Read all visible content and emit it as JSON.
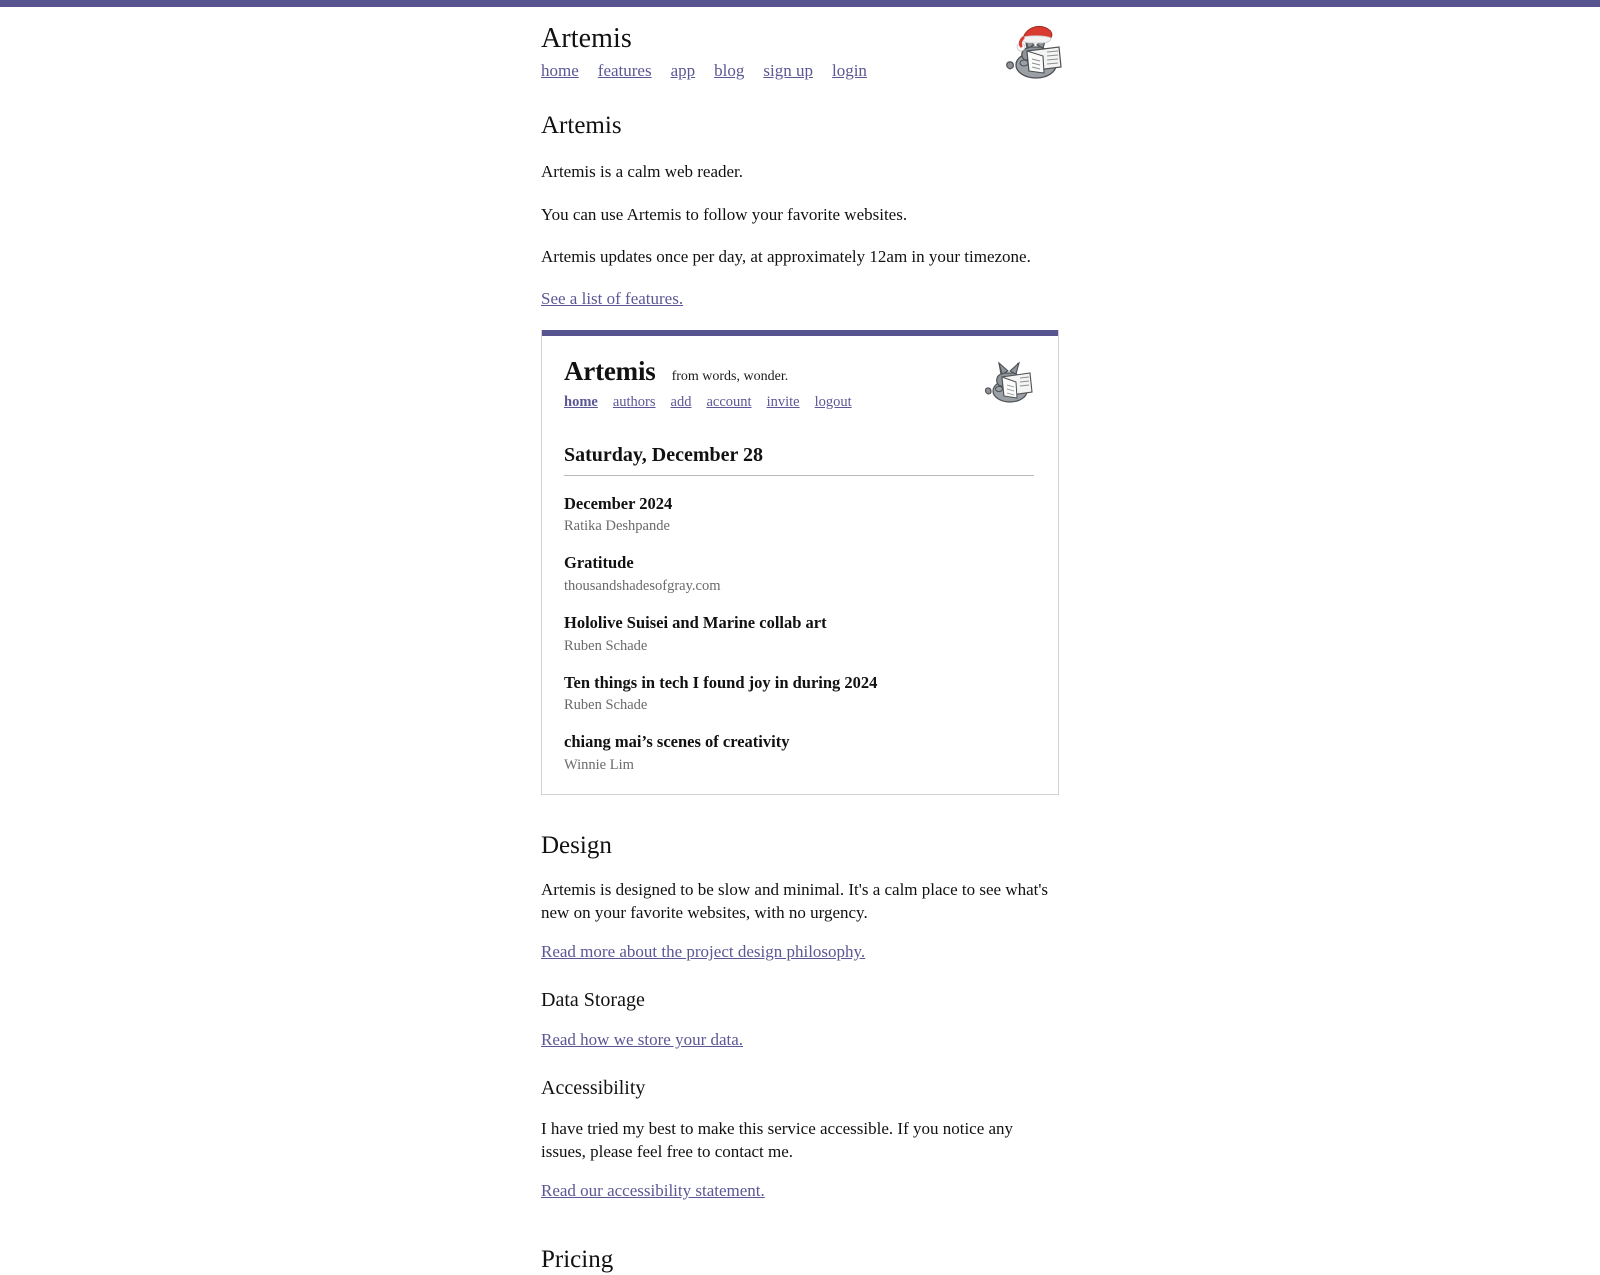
{
  "theme": {
    "accent": "#575490",
    "link": "#5b5795",
    "text": "#111111",
    "muted": "#6a6a6a",
    "card_border": "#d2d2d8",
    "rule": "#b9b9b9"
  },
  "site_header": {
    "title": "Artemis",
    "logo_icon": "cat-reading-newspaper-santa-hat-icon",
    "nav": [
      {
        "label": "home"
      },
      {
        "label": "features"
      },
      {
        "label": "app"
      },
      {
        "label": "blog"
      },
      {
        "label": "sign up"
      },
      {
        "label": "login"
      }
    ]
  },
  "intro": {
    "heading": "Artemis",
    "paragraphs": [
      "Artemis is a calm web reader.",
      "You can use Artemis to follow your favorite websites.",
      "Artemis updates once per day, at approximately 12am in your timezone."
    ],
    "features_link": "See a list of features."
  },
  "screenshot": {
    "app_title": "Artemis",
    "tagline": "from words, wonder.",
    "logo_icon": "cat-reading-newspaper-icon",
    "nav": [
      {
        "label": "home",
        "active": true
      },
      {
        "label": "authors",
        "active": false
      },
      {
        "label": "add",
        "active": false
      },
      {
        "label": "account",
        "active": false
      },
      {
        "label": "invite",
        "active": false
      },
      {
        "label": "logout",
        "active": false
      }
    ],
    "date_heading": "Saturday, December 28",
    "entries": [
      {
        "title": "December 2024",
        "author": "Ratika Deshpande"
      },
      {
        "title": "Gratitude",
        "author": "thousandshadesofgray.com"
      },
      {
        "title": "Hololive Suisei and Marine collab art",
        "author": "Ruben Schade"
      },
      {
        "title": "Ten things in tech I found joy in during 2024",
        "author": "Ruben Schade"
      },
      {
        "title": "chiang mai’s scenes of creativity",
        "author": "Winnie Lim"
      }
    ]
  },
  "design": {
    "heading": "Design",
    "body": "Artemis is designed to be slow and minimal. It's a calm place to see what's new on your favorite websites, with no urgency.",
    "link": "Read more about the project design philosophy."
  },
  "data_storage": {
    "heading": "Data Storage",
    "link": "Read how we store your data."
  },
  "accessibility": {
    "heading": "Accessibility",
    "body": "I have tried my best to make this service accessible. If you notice any issues, please feel free to contact me.",
    "link": "Read our accessibility statement."
  },
  "pricing": {
    "heading": "Pricing"
  }
}
